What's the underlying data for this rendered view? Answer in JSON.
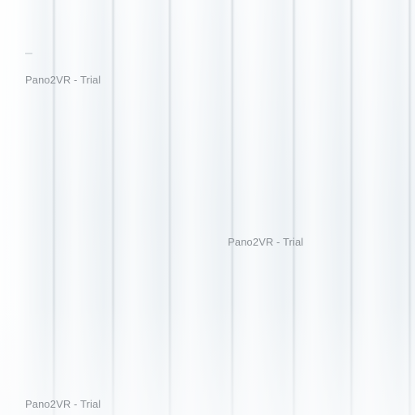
{
  "viewer": {
    "watermarks": [
      "Pano2VR - Trial",
      "Pano2VR - Trial",
      "Pano2VR - Trial"
    ]
  }
}
